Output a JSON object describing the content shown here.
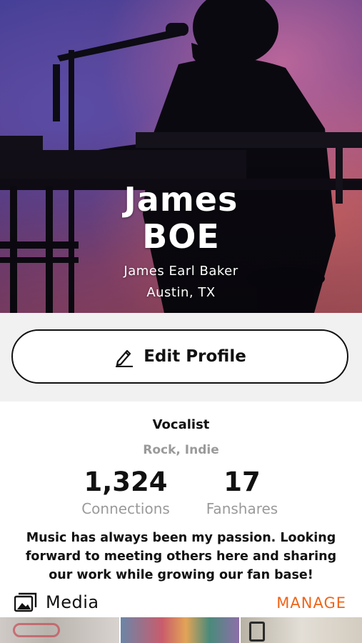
{
  "profile": {
    "first_name": "James",
    "last_name": "BOE",
    "full_name": "James Earl Baker",
    "location": "Austin, TX",
    "role": "Vocalist",
    "genres": "Rock, Indie",
    "bio": "Music has always been my passion. Looking forward to meeting others here and sharing our work while growing our fan base!"
  },
  "actions": {
    "edit_profile_label": "Edit Profile",
    "edit_icon": "pencil-icon"
  },
  "stats": [
    {
      "value": "1,324",
      "label": "Connections"
    },
    {
      "value": "17",
      "label": "Fanshares"
    }
  ],
  "media": {
    "title": "Media",
    "icon": "photo-gallery-icon",
    "manage_label": "MANAGE"
  },
  "colors": {
    "accent": "#f06418",
    "muted_text": "#9a9a9a",
    "band_background": "#f1f1f1"
  }
}
